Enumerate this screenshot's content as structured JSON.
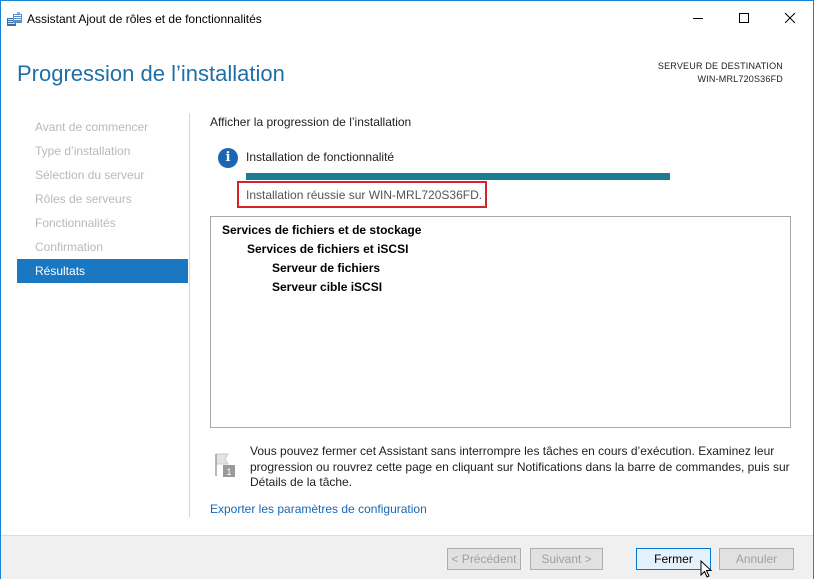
{
  "window": {
    "title": "Assistant Ajout de rôles et de fonctionnalités",
    "controls": {
      "minimize": "—",
      "maximize": "☐",
      "close": "✕"
    }
  },
  "header": {
    "title": "Progression de l’installation",
    "destination_label": "SERVEUR DE DESTINATION",
    "destination_server": "WIN-MRL720S36FD"
  },
  "nav": {
    "items": [
      {
        "label": "Avant de commencer",
        "active": false
      },
      {
        "label": "Type d’installation",
        "active": false
      },
      {
        "label": "Sélection du serveur",
        "active": false
      },
      {
        "label": "Rôles de serveurs",
        "active": false
      },
      {
        "label": "Fonctionnalités",
        "active": false
      },
      {
        "label": "Confirmation",
        "active": false
      },
      {
        "label": "Résultats",
        "active": true
      }
    ]
  },
  "main": {
    "subtitle": "Afficher la progression de l’installation",
    "install_label": "Installation de fonctionnalité",
    "progress_percent": 100,
    "success_text": "Installation réussie sur WIN-MRL720S36FD.",
    "results": [
      {
        "label": "Services de fichiers et de stockage",
        "level": 0
      },
      {
        "label": "Services de fichiers et iSCSI",
        "level": 1
      },
      {
        "label": "Serveur de fichiers",
        "level": 2
      },
      {
        "label": "Serveur cible iSCSI",
        "level": 2
      }
    ],
    "note": "Vous pouvez fermer cet Assistant sans interrompre les tâches en cours d’exécution. Examinez leur progression ou rouvrez cette page en cliquant sur Notifications dans la barre de commandes, puis sur Détails de la tâche.",
    "export_link": "Exporter les paramètres de configuration"
  },
  "footer": {
    "prev_label": "< Précédent",
    "next_label": "Suivant >",
    "close_label": "Fermer",
    "cancel_label": "Annuler"
  },
  "colors": {
    "accent": "#1a78c2",
    "title": "#1e6fa8",
    "progress": "#1b7d8f",
    "highlight_border": "#d4232b"
  }
}
